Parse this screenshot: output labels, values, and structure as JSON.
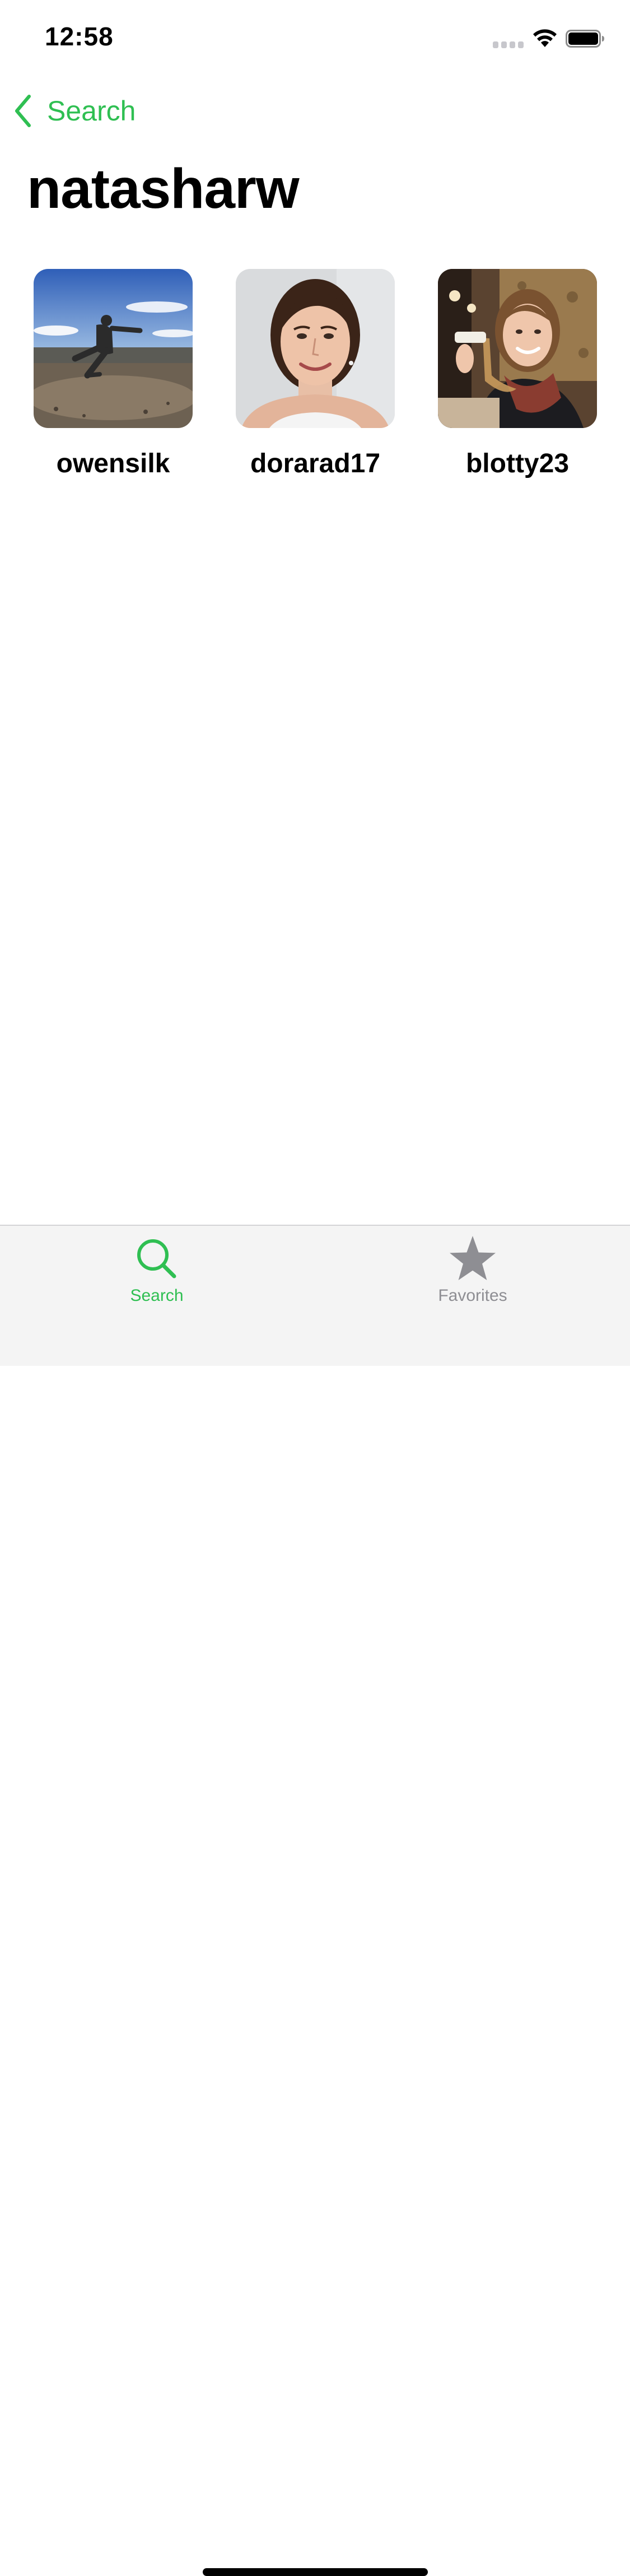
{
  "status_bar": {
    "time": "12:58"
  },
  "nav": {
    "back_label": "Search"
  },
  "page": {
    "title": "natasharw"
  },
  "followers": [
    {
      "username": "owensilk"
    },
    {
      "username": "dorarad17"
    },
    {
      "username": "blotty23"
    }
  ],
  "tab_bar": {
    "tabs": [
      {
        "label": "Search",
        "icon": "search-icon",
        "selected": true
      },
      {
        "label": "Favorites",
        "icon": "star-icon",
        "selected": false
      }
    ]
  },
  "colors": {
    "accent": "#2fbf52",
    "inactive": "#8e8e93",
    "tab_bar_bg": "#f4f4f4"
  }
}
